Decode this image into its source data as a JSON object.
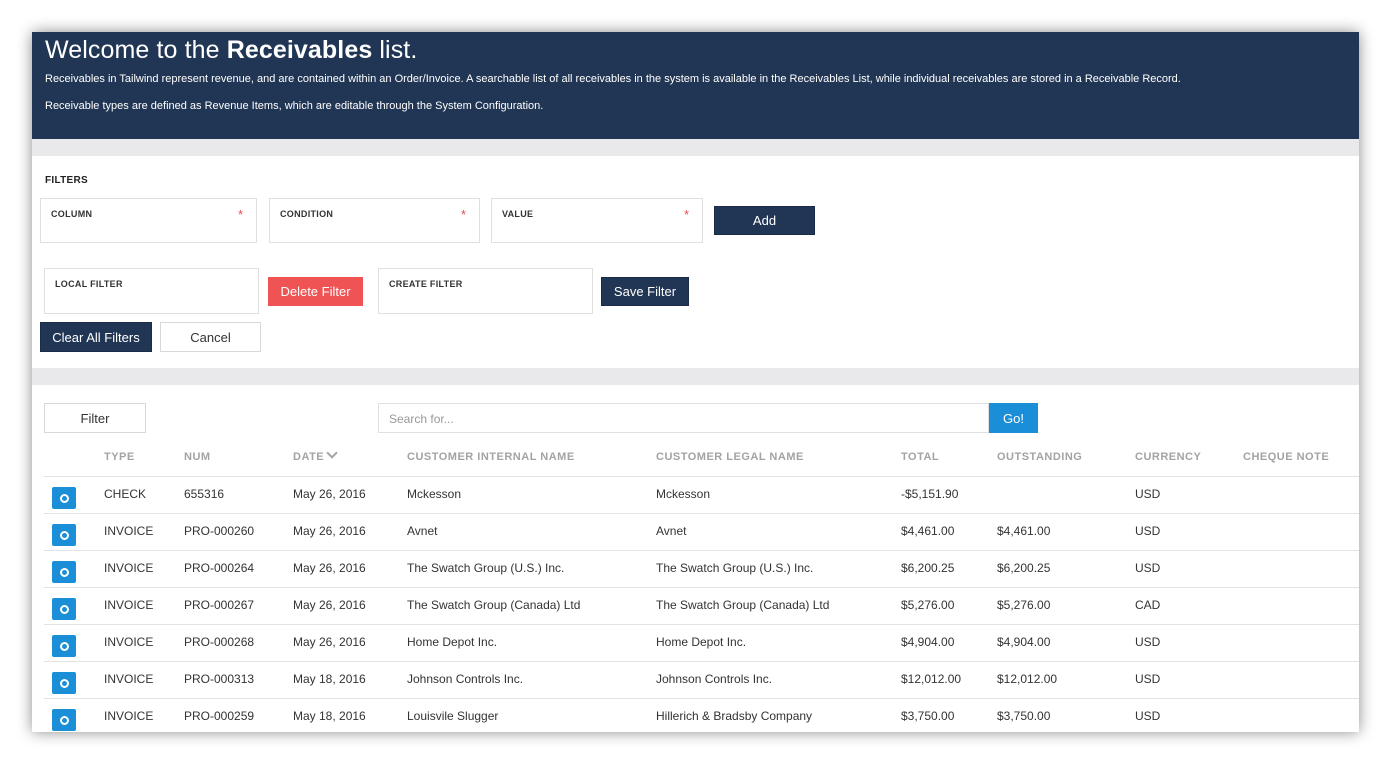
{
  "hero": {
    "title_prefix": "Welcome to the ",
    "title_bold": "Receivables",
    "title_suffix": " list.",
    "para1": "Receivables in Tailwind represent revenue, and are contained within an Order/Invoice. A searchable list of all receivables in the system is available in the Receivables List, while individual receivables are stored in a Receivable Record.",
    "para2": "Receivable types are defined as Revenue Items, which are editable through the System Configuration."
  },
  "filters": {
    "title": "FILTERS",
    "column_label": "COLUMN",
    "condition_label": "CONDITION",
    "value_label": "VALUE",
    "required_mark": "*",
    "add_label": "Add",
    "local_filter_label": "LOCAL FILTER",
    "delete_filter_label": "Delete Filter",
    "create_filter_label": "CREATE FILTER",
    "save_filter_label": "Save Filter",
    "clear_all_label": "Clear All Filters",
    "cancel_label": "Cancel"
  },
  "list": {
    "filter_button": "Filter",
    "search_placeholder": "Search for...",
    "go_label": "Go!",
    "columns": [
      "TYPE",
      "NUM",
      "DATE",
      "CUSTOMER INTERNAL NAME",
      "CUSTOMER LEGAL NAME",
      "TOTAL",
      "OUTSTANDING",
      "CURRENCY",
      "CHEQUE NOTE"
    ],
    "sort_icon": "chevron-down-icon",
    "rows": [
      {
        "type": "CHECK",
        "num": "655316",
        "date": "May 26, 2016",
        "internal": "Mckesson",
        "legal": "Mckesson",
        "total": "-$5,151.90",
        "outstanding": "",
        "currency": "USD",
        "note": ""
      },
      {
        "type": "INVOICE",
        "num": "PRO-000260",
        "date": "May 26, 2016",
        "internal": "Avnet",
        "legal": "Avnet",
        "total": "$4,461.00",
        "outstanding": "$4,461.00",
        "currency": "USD",
        "note": ""
      },
      {
        "type": "INVOICE",
        "num": "PRO-000264",
        "date": "May 26, 2016",
        "internal": "The Swatch Group (U.S.) Inc.",
        "legal": "The Swatch Group (U.S.) Inc.",
        "total": "$6,200.25",
        "outstanding": "$6,200.25",
        "currency": "USD",
        "note": ""
      },
      {
        "type": "INVOICE",
        "num": "PRO-000267",
        "date": "May 26, 2016",
        "internal": "The Swatch Group (Canada) Ltd",
        "legal": "The Swatch Group (Canada) Ltd",
        "total": "$5,276.00",
        "outstanding": "$5,276.00",
        "currency": "CAD",
        "note": ""
      },
      {
        "type": "INVOICE",
        "num": "PRO-000268",
        "date": "May 26, 2016",
        "internal": "Home Depot Inc.",
        "legal": "Home Depot Inc.",
        "total": "$4,904.00",
        "outstanding": "$4,904.00",
        "currency": "USD",
        "note": ""
      },
      {
        "type": "INVOICE",
        "num": "PRO-000313",
        "date": "May 18, 2016",
        "internal": "Johnson Controls Inc.",
        "legal": "Johnson Controls Inc.",
        "total": "$12,012.00",
        "outstanding": "$12,012.00",
        "currency": "USD",
        "note": ""
      },
      {
        "type": "INVOICE",
        "num": "PRO-000259",
        "date": "May 18, 2016",
        "internal": "Louisvile Slugger",
        "legal": "Hillerich & Bradsby Company",
        "total": "$3,750.00",
        "outstanding": "$3,750.00",
        "currency": "USD",
        "note": ""
      }
    ]
  },
  "colors": {
    "navy": "#213654",
    "blue": "#1a8fd8",
    "red": "#ef5353"
  }
}
